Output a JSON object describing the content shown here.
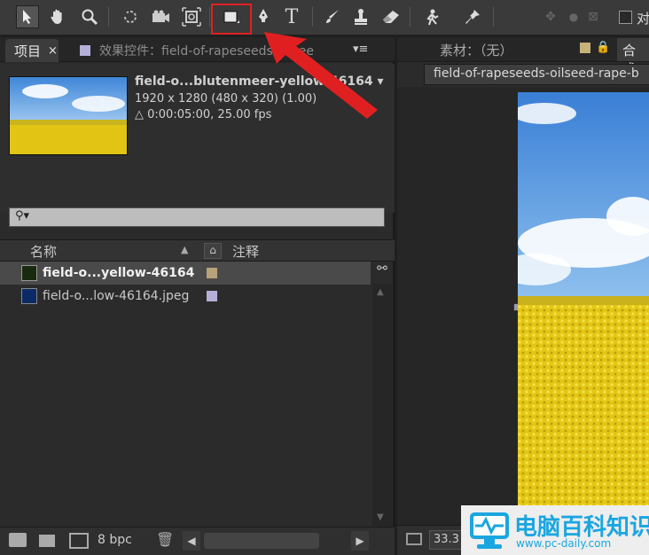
{
  "toolbar": {
    "tools": [
      "selection-tool",
      "hand-tool",
      "zoom-tool",
      "rotation-tool",
      "camera-orbit-tool",
      "pan-behind-tool",
      "rectangle-tool",
      "pen-tool",
      "text-tool",
      "brush-tool",
      "clone-stamp-tool",
      "eraser-tool",
      "roto-brush-tool",
      "puppet-pin-tool"
    ],
    "text_tool_glyph": "T",
    "right_label": "对"
  },
  "project_panel": {
    "tab_project": "项目",
    "tab_close": "×",
    "tab_effects": "效果控件：field-of-rapeseeds-oilsee",
    "menu_glyph": "▾≡",
    "file_name": "field-o...blutenmeer-yellow-46164 ▾",
    "file_dims": "1920 x 1280  (480 x 320) (1.00)",
    "file_duration": "△ 0:00:05:00, 25.00 fps",
    "search_glyph": "⚲▾",
    "columns": {
      "name": "名称",
      "comment": "注释"
    },
    "items": [
      {
        "name": "field-o...yellow-46164",
        "label_color": "#b8a27a"
      },
      {
        "name": "field-o...low-46164.jpeg",
        "label_color": "#b5b0d8"
      }
    ],
    "bpc": "8 bpc"
  },
  "viewer": {
    "tab_footage": "素材：（无）",
    "tab_comp": "合成",
    "dropdown": "field-of-rapeseeds-oilseed-rape-b",
    "zoom": "33.3"
  },
  "watermark": {
    "title": "电脑百科知识",
    "url": "www.pc-daily.com"
  },
  "colors": {
    "highlight": "#e02020",
    "arrow": "#e02020",
    "sky": "#5a9be0",
    "field": "#e8cf1a",
    "logo": "#1aa6e0"
  }
}
